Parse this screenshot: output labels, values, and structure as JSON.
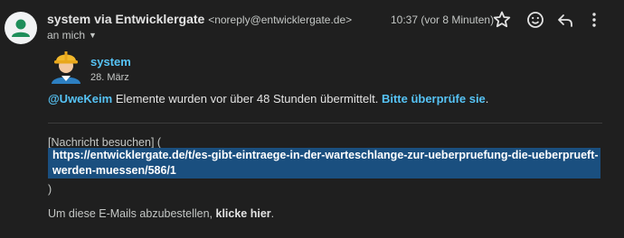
{
  "header": {
    "sender_name": "system via Entwicklergate",
    "sender_email": "<noreply@entwicklergate.de>",
    "recipient": "an mich",
    "timestamp": "10:37 (vor 8 Minuten)"
  },
  "icons": {
    "avatar": "person-icon",
    "star": "star-icon",
    "emoji": "emoji-icon",
    "reply": "reply-icon",
    "more": "more-vert-icon"
  },
  "post": {
    "user": "system",
    "date": "28. März",
    "mention": "@UweKeim",
    "message": " Elemente wurden vor über 48 Stunden übermittelt. ",
    "link_text": "Bitte überprüfe sie",
    "trailing": "."
  },
  "footer": {
    "visit_label": "[Nachricht besuchen] (",
    "url": "https://entwicklergate.de/t/es-gibt-eintraege-in-der-warteschlange-zur-ueberpruefung-die-ueberprueft-werden-muessen/586/1",
    "close_paren": ")",
    "unsubscribe_prefix": "Um diese E-Mails abzubestellen, ",
    "unsubscribe_link": "klicke hier",
    "unsubscribe_suffix": "."
  },
  "colors": {
    "background": "#1f1f1f",
    "link": "#56c3f5",
    "url_highlight": "#1a4f7f",
    "avatar_green": "#1e8e5a"
  }
}
